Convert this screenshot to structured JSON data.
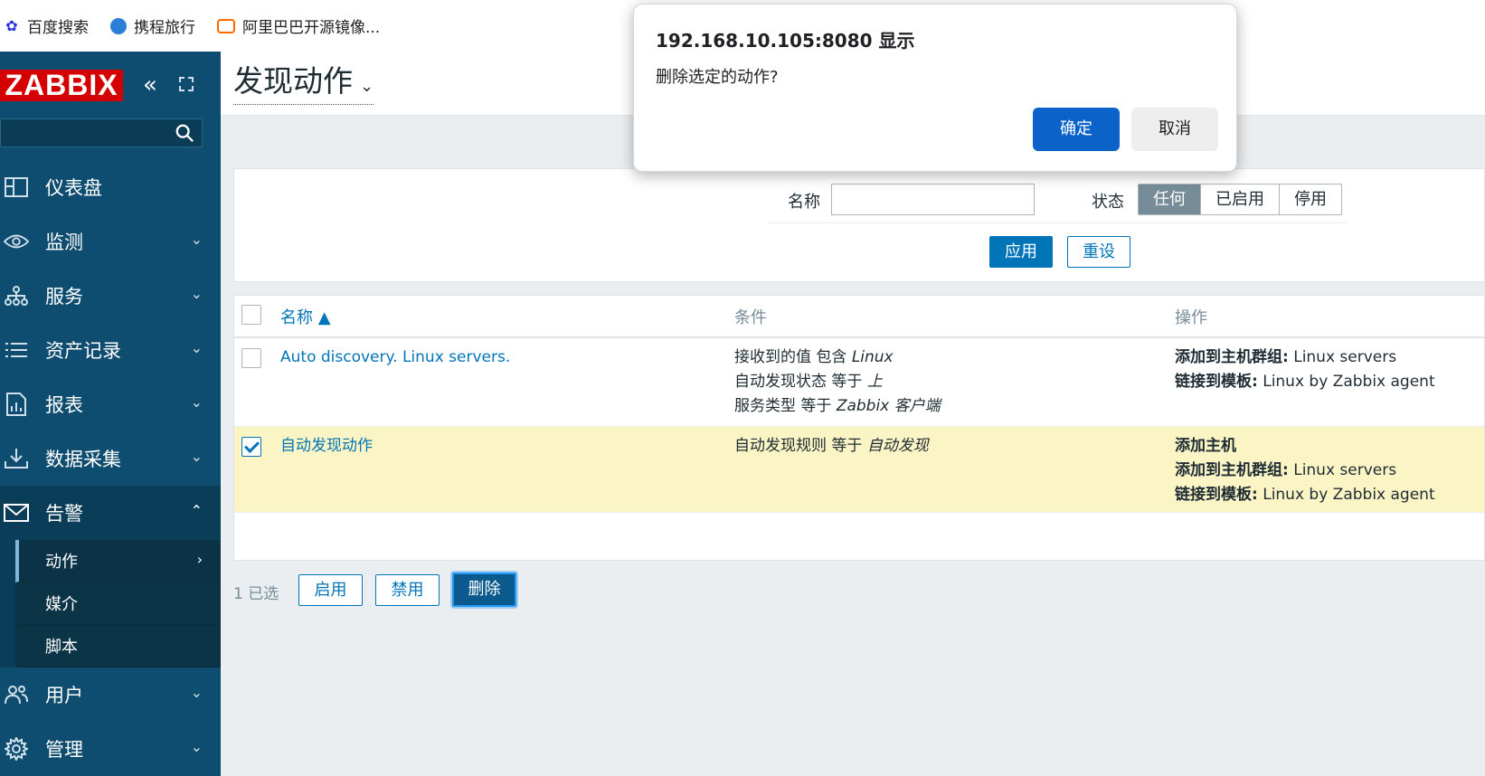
{
  "bookmarks": [
    {
      "label": "百度搜索",
      "icon": "baidu-paw-icon"
    },
    {
      "label": "携程旅行",
      "icon": "ctrip-dolphin-icon"
    },
    {
      "label": "阿里巴巴开源镜像...",
      "icon": "alibaba-cloud-icon"
    }
  ],
  "sidebar": {
    "logo": "ZABBIX",
    "search_placeholder": "",
    "items": [
      {
        "label": "仪表盘",
        "icon": "dashboard-icon"
      },
      {
        "label": "监测",
        "icon": "eye-icon"
      },
      {
        "label": "服务",
        "icon": "services-tree-icon"
      },
      {
        "label": "资产记录",
        "icon": "list-icon"
      },
      {
        "label": "报表",
        "icon": "report-icon"
      },
      {
        "label": "数据采集",
        "icon": "download-icon"
      },
      {
        "label": "告警",
        "icon": "envelope-icon"
      },
      {
        "label": "用户",
        "icon": "users-icon"
      },
      {
        "label": "管理",
        "icon": "gear-icon"
      }
    ],
    "alerts_sub": [
      "动作",
      "媒介",
      "脚本"
    ]
  },
  "header": {
    "title": "发现动作"
  },
  "filter": {
    "name_label": "名称",
    "name_value": "",
    "status_label": "状态",
    "status_options": [
      "任何",
      "已启用",
      "停用"
    ],
    "status_selected": "任何",
    "apply": "应用",
    "reset": "重设"
  },
  "table": {
    "columns": [
      "名称 ▲",
      "条件",
      "操作"
    ],
    "rows": [
      {
        "checked": false,
        "name": "Auto discovery. Linux servers.",
        "conditions": [
          {
            "text": "接收到的值 包含 ",
            "value": "Linux"
          },
          {
            "text": "自动发现状态 等于 ",
            "value": "上"
          },
          {
            "text": "服务类型 等于 ",
            "value": "Zabbix 客户端"
          }
        ],
        "operations": [
          {
            "label": "添加到主机群组:",
            "value": " Linux servers"
          },
          {
            "label": "链接到模板:",
            "value": " Linux by Zabbix agent"
          }
        ]
      },
      {
        "checked": true,
        "name": "自动发现动作",
        "conditions": [
          {
            "text": "自动发现规则 等于 ",
            "value": "自动发现"
          }
        ],
        "operations": [
          {
            "label": "添加主机",
            "value": ""
          },
          {
            "label": "添加到主机群组:",
            "value": " Linux servers"
          },
          {
            "label": "链接到模板:",
            "value": " Linux by Zabbix agent"
          }
        ]
      }
    ]
  },
  "footer": {
    "selected": "1 已选",
    "enable": "启用",
    "disable": "禁用",
    "delete": "删除"
  },
  "dialog": {
    "title": "192.168.10.105:8080 显示",
    "message": "删除选定的动作?",
    "ok": "确定",
    "cancel": "取消"
  },
  "colors": {
    "sidebar": "#0e4d6f",
    "accent": "#0275b8",
    "logo": "#d40000",
    "selected_row": "#fbf4c5"
  }
}
